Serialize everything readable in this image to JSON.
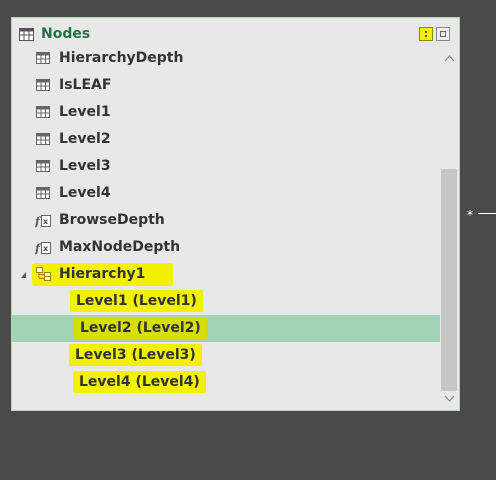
{
  "table": {
    "title": "Nodes",
    "columns": [
      {
        "label": "HierarchyDepth",
        "icon": "column-icon"
      },
      {
        "label": "IsLEAF",
        "icon": "column-icon"
      },
      {
        "label": "Level1",
        "icon": "column-icon"
      },
      {
        "label": "Level2",
        "icon": "column-icon"
      },
      {
        "label": "Level3",
        "icon": "column-icon"
      },
      {
        "label": "Level4",
        "icon": "column-icon"
      },
      {
        "label": "BrowseDepth",
        "icon": "measure-icon"
      },
      {
        "label": "MaxNodeDepth",
        "icon": "measure-icon"
      }
    ],
    "hierarchy": {
      "label": "Hierarchy1",
      "icon": "hierarchy-icon",
      "levels": [
        {
          "label": "Level1 (Level1)"
        },
        {
          "label": "Level2 (Level2)",
          "selected": true
        },
        {
          "label": "Level3 (Level3)"
        },
        {
          "label": "Level4 (Level4)"
        }
      ]
    }
  },
  "relationship": {
    "cardinality": "*"
  },
  "colors": {
    "title": "#217346",
    "highlight": "#f2f200",
    "selected_row": "#a3d3b6",
    "background": "#4a4a4a"
  }
}
